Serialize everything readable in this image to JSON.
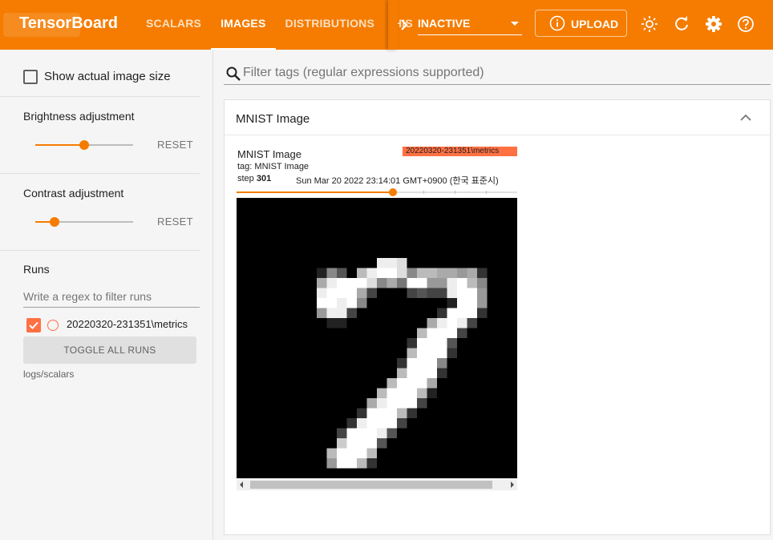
{
  "app": {
    "title": "TensorBoard"
  },
  "nav": {
    "tabs": [
      {
        "label": "SCALARS"
      },
      {
        "label": "IMAGES"
      },
      {
        "label": "DISTRIBUTIONS"
      },
      {
        "label": "HIS"
      }
    ],
    "active_tab": "IMAGES",
    "plugin_select": "INACTIVE",
    "upload_label": "UPLOAD"
  },
  "sidebar": {
    "show_actual_size_label": "Show actual image size",
    "brightness": {
      "title": "Brightness adjustment",
      "reset_label": "RESET",
      "value": 0.5
    },
    "contrast": {
      "title": "Contrast adjustment",
      "reset_label": "RESET",
      "value": 0.2
    },
    "runs": {
      "title": "Runs",
      "filter_placeholder": "Write a regex to filter runs",
      "items": [
        {
          "label": "20220320-231351\\metrics",
          "checked": true,
          "color": "#ff7043"
        }
      ],
      "toggle_label": "TOGGLE ALL RUNS",
      "logdir": "logs/scalars"
    }
  },
  "main": {
    "search_placeholder": "Filter tags (regular expressions supported)",
    "card": {
      "title": "MNIST Image",
      "image": {
        "title": "MNIST Image",
        "run": "20220320-231351\\metrics",
        "tag": "tag: MNIST Image",
        "step_label": "step",
        "step": "301",
        "date": "Sun Mar 20 2022 23:14:01 GMT+0900 (한국 표준시)",
        "step_position": 0.56,
        "pixels": [
          "0000000000000000000000000000",
          "0000000000000000000000000000",
          "0000000000000000000000000000",
          "0000000000000000000000000000",
          "0000000000000000000000000000",
          "0000000000000000000000000000",
          "00000000000000eed00000000000",
          "000000002850beffd8bbaa9a3000",
          "00000000aefffd8a7ff99efb8000",
          "00000000efffa40004544eff9000",
          "00000000ffef8000000002ff9000",
          "000000009ee4000000003fff3000",
          "0000000002200000000aefe40000",
          "000000000000000000bfff400000",
          "000000000000000003fff5000000",
          "00000000000000000bfff3000000",
          "00000000000000003fff80000000",
          "0000000000000000bfff30000000",
          "000000000000000bfffa00000000",
          "00000000000000bfffb200000000",
          "0000000000000aefff4000000000",
          "0000000000003fffb30000000000",
          "000000000003efff400000000000",
          "00000000004fffe5000000000000",
          "0000000000cfff50000000000000",
          "000000000bfffb00000000000000",
          "0000000009ffb300000000000000",
          "0000000000000000000000000000"
        ]
      }
    }
  },
  "colors": {
    "accent": "#f57c00",
    "run": "#ff7043"
  }
}
